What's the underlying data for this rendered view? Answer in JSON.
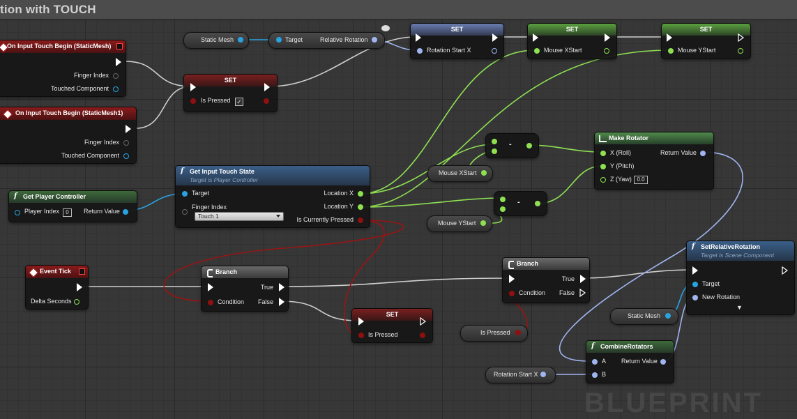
{
  "window": {
    "title": "tion with TOUCH",
    "watermark": "BLUEPRINT"
  },
  "colors": {
    "exec": "#ffffff",
    "bool": "#8e1010",
    "float": "#8ee052",
    "object": "#29a3e0",
    "rotator": "#a0b4f0"
  },
  "nodes": {
    "touch1": {
      "title": "On Input Touch Begin (StaticMesh)",
      "pin1": "Finger Index",
      "pin2": "Touched Component"
    },
    "touch2": {
      "title": "On Input Touch Begin (StaticMesh1)",
      "pin1": "Finger Index",
      "pin2": "Touched Component"
    },
    "set1": {
      "title": "SET",
      "pin": "Is Pressed",
      "checked": "✓"
    },
    "staticmesh_var1": {
      "label": "Static Mesh"
    },
    "rel_rot": {
      "in": "Target",
      "out": "Relative Rotation"
    },
    "set_rot": {
      "title": "SET",
      "pin": "Rotation Start X"
    },
    "set_mx": {
      "title": "SET",
      "pin": "Mouse XStart"
    },
    "set_my": {
      "title": "SET",
      "pin": "Mouse YStart"
    },
    "player_ctrl": {
      "title": "Get Player Controller",
      "in": "Player Index",
      "in_val": "0",
      "out": "Return Value"
    },
    "touch_state": {
      "title": "Get Input Touch State",
      "subtitle": "Target is Player Controller",
      "target": "Target",
      "finger": "Finger Index",
      "dropdown": "Touch 1",
      "out1": "Location X",
      "out2": "Location Y",
      "out3": "Is Currently Pressed"
    },
    "minus1": {
      "op": "-"
    },
    "minus2": {
      "op": "-"
    },
    "mouse_xstart_var": {
      "label": "Mouse XStart"
    },
    "mouse_ystart_var": {
      "label": "Mouse YStart"
    },
    "make_rot": {
      "title": "Make Rotator",
      "x": "X (Roll)",
      "y": "Y (Pitch)",
      "z": "Z (Yaw)",
      "z_val": "0.0",
      "out": "Return Value"
    },
    "event_tick": {
      "title": "Event Tick",
      "out": "Delta Seconds"
    },
    "branch1": {
      "title": "Branch",
      "cond": "Condition",
      "t": "True",
      "f": "False"
    },
    "branch2": {
      "title": "Branch",
      "cond": "Condition",
      "t": "True",
      "f": "False"
    },
    "set2": {
      "title": "SET",
      "pin": "Is Pressed"
    },
    "is_pressed_var": {
      "label": "Is Pressed"
    },
    "set_rel_rot": {
      "title": "SetRelativeRotation",
      "subtitle": "Target is Scene Component",
      "target": "Target",
      "new_rot": "New Rotation",
      "expand": "▼"
    },
    "staticmesh_var2": {
      "label": "Static Mesh"
    },
    "combine": {
      "title": "CombineRotators",
      "a": "A",
      "b": "B",
      "out": "Return Value"
    },
    "rot_start_var": {
      "label": "Rotation Start X"
    }
  }
}
